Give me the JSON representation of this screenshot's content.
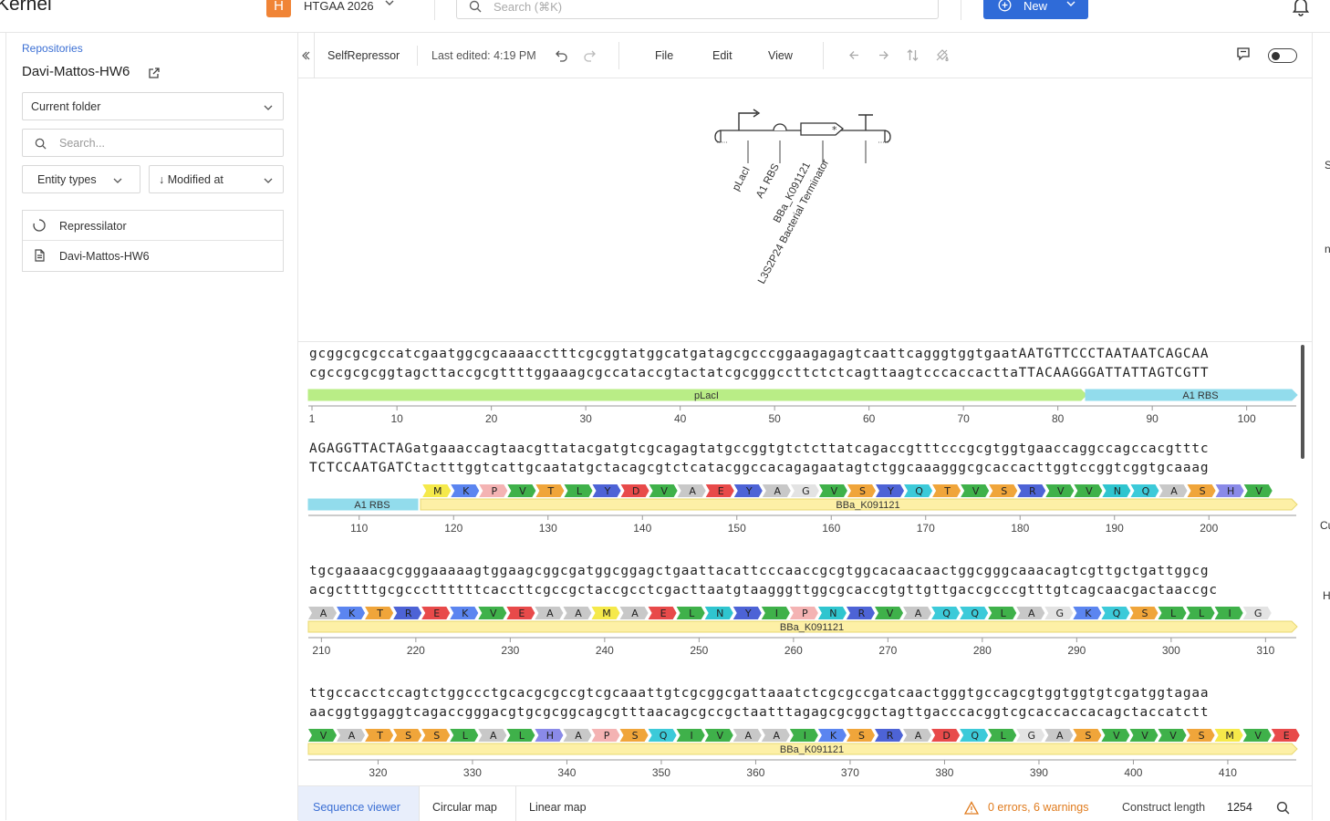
{
  "app": {
    "logo": "Kernel"
  },
  "org": {
    "initial": "H",
    "name": "HTGAA 2026"
  },
  "search": {
    "placeholder": "Search (⌘K)"
  },
  "new_button": {
    "label": "New"
  },
  "sidebar": {
    "repositories_link": "Repositories",
    "repo_title": "Davi-Mattos-HW6",
    "folder_select": "Current folder",
    "search_placeholder": "Search...",
    "entity_types": "Entity types",
    "sort": "↓ Modified at",
    "items": [
      {
        "label": "Repressilator",
        "icon": "circle-sequence-icon"
      },
      {
        "label": "Davi-Mattos-HW6",
        "icon": "document-icon"
      }
    ]
  },
  "editor": {
    "doc_name": "SelfRepressor",
    "last_edited": "Last edited: 4:19 PM",
    "menus": [
      "File",
      "Edit",
      "View"
    ]
  },
  "map": {
    "labels": [
      "pLacI",
      "A1 RBS",
      "BBa_K091121",
      "L3S2P24 Bacterial Terminator"
    ]
  },
  "sequence_rows": [
    {
      "top": "gcggcgcgccatcgaatggcgcaaaacctttcgcggtatggcatgatagcgcccggaagagagtcaattcagggtggtgaatAATGTTCCCTAATAATCAGCAA",
      "bottom": "cgccgcgcggtagcttaccgcgttttggaaagcgccataccgtactatcgcgggccttctctcagttaagtcccaccacttaTTACAAGGGATTATTAGTCGTT",
      "start": 1,
      "ticks": [
        "1",
        "10",
        "20",
        "30",
        "40",
        "50",
        "60",
        "70",
        "80",
        "90",
        "100"
      ],
      "features": [
        {
          "name": "pLacI",
          "color": "#b9ed86"
        },
        {
          "name": "A1 RBS",
          "color": "#92dcec"
        }
      ],
      "aa": []
    },
    {
      "top": "AGAGGTTACTAGatgaaaccagtaacgttatacgatgtcgcagagtatgccggtgtctcttatcagaccgtttcccgcgtggtgaaccaggccagccacgtttc",
      "bottom": "TCTCCAATGATCtactttggtcattgcaatatgctacagcgtctcatacggccacagagaatagtctggcaaagggcgcaccacttggtccggtcggtgcaaag",
      "start": 105,
      "ticks": [
        "110",
        "120",
        "130",
        "140",
        "150",
        "160",
        "170",
        "180",
        "190",
        "200"
      ],
      "features": [
        {
          "name": "A1 RBS",
          "color": "#92dcec"
        },
        {
          "name": "BBa_K091121",
          "color": "#fdf0a6"
        }
      ],
      "aa": [
        "M",
        "K",
        "P",
        "V",
        "T",
        "L",
        "Y",
        "D",
        "V",
        "A",
        "E",
        "Y",
        "A",
        "G",
        "V",
        "S",
        "Y",
        "Q",
        "T",
        "V",
        "S",
        "R",
        "V",
        "V",
        "N",
        "Q",
        "A",
        "S",
        "H",
        "V",
        "S"
      ]
    },
    {
      "top": "tgcgaaaacgcgggaaaaagtggaagcggcgatggcggagctgaattacattcccaaccgcgtggcacaacaactggcgggcaaacagtcgttgctgattggcg",
      "bottom": "acgcttttgcgcccttttttcaccttcgccgctaccgcctcgacttaatgtaagggttggcgcaccgtgttgttgaccgcccgtttgtcagcaacgactaaccgc",
      "start": 209,
      "ticks": [
        "210",
        "220",
        "230",
        "240",
        "250",
        "260",
        "270",
        "280",
        "290",
        "300",
        "310"
      ],
      "features": [
        {
          "name": "BBa_K091121",
          "color": "#fdf0a6"
        }
      ],
      "aa": [
        "A",
        "K",
        "T",
        "R",
        "E",
        "K",
        "V",
        "E",
        "A",
        "A",
        "M",
        "A",
        "E",
        "L",
        "N",
        "Y",
        "I",
        "P",
        "N",
        "R",
        "V",
        "A",
        "Q",
        "Q",
        "L",
        "A",
        "G",
        "K",
        "Q",
        "S",
        "L",
        "L",
        "I",
        "G"
      ]
    },
    {
      "top": "ttgccacctccagtctggccctgcacgcgccgtcgcaaattgtcgcggcgattaaatctcgcgccgatcaactgggtgccagcgtggtggtgtcgatggtagaa",
      "bottom": "aacggtggaggtcagaccgggacgtgcgcggcagcgtttaacagcgccgctaatttagagcgcggctagttgacccacggtcgcaccaccacagctaccatctt",
      "start": 313,
      "ticks": [
        "320",
        "330",
        "340",
        "350",
        "360",
        "370",
        "380",
        "390",
        "400",
        "410"
      ],
      "features": [
        {
          "name": "BBa_K091121",
          "color": "#fdf0a6"
        }
      ],
      "aa": [
        "V",
        "A",
        "T",
        "S",
        "S",
        "L",
        "A",
        "L",
        "H",
        "A",
        "P",
        "S",
        "Q",
        "I",
        "V",
        "A",
        "A",
        "I",
        "K",
        "S",
        "R",
        "A",
        "D",
        "Q",
        "L",
        "G",
        "A",
        "S",
        "V",
        "V",
        "V",
        "S",
        "M",
        "V",
        "E"
      ]
    }
  ],
  "bottom": {
    "tabs": [
      "Sequence viewer",
      "Circular map",
      "Linear map"
    ],
    "warnings": "0 errors, 6 warnings",
    "construct_label": "Construct length",
    "construct_value": "1254"
  },
  "right_strip": [
    "S",
    "n",
    "Cu",
    "H"
  ],
  "aa_colors": {
    "M": "#f5e94a",
    "K": "#5b85f0",
    "P": "#f4b3b3",
    "V": "#3fb14a",
    "T": "#f0a53a",
    "L": "#3fb14a",
    "Y": "#4d63d6",
    "D": "#e84a4a",
    "A": "#c8c8c8",
    "E": "#e84a4a",
    "G": "#e3e3e3",
    "S": "#f0a53a",
    "Q": "#3ccad9",
    "R": "#4d63d6",
    "N": "#2fc5cf",
    "H": "#8a8ae8",
    "I": "#3fb14a"
  }
}
